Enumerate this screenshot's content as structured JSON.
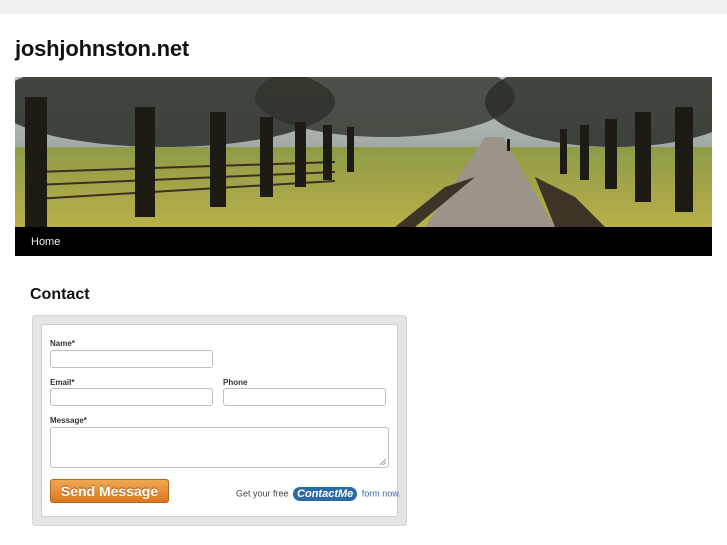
{
  "site": {
    "title": "joshjohnston.net"
  },
  "nav": {
    "items": [
      {
        "label": "Home"
      }
    ]
  },
  "page": {
    "heading": "Contact"
  },
  "form": {
    "fields": {
      "name": {
        "label": "Name*",
        "value": ""
      },
      "email": {
        "label": "Email*",
        "value": ""
      },
      "phone": {
        "label": "Phone",
        "value": ""
      },
      "message": {
        "label": "Message*",
        "value": ""
      }
    },
    "submit_label": "Send Message",
    "promo": {
      "before": "Get your free",
      "logo": "ContactMe",
      "after": "form now."
    }
  },
  "colors": {
    "accent": "#e08a2e",
    "link": "#2b6aa8",
    "nav_bg": "#000000"
  }
}
